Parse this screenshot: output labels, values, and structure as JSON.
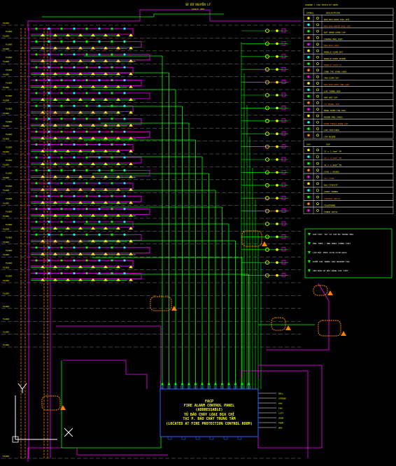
{
  "drawing": {
    "top_title": "SƠ ĐỒ NGUYÊN LÝ",
    "top_subtitle": "SCALE: NTS",
    "floor_label": "FLOOR",
    "colors": {
      "background": "#000000",
      "loop_green": "#00ff00",
      "loop_magenta": "#ff00ff",
      "riser_orange": "#ff8000",
      "device_yellow": "#ffff00",
      "cyan": "#00ffff",
      "blue": "#3060ff",
      "grey_dash": "#808080"
    }
  },
  "panel": {
    "lines": [
      "FACP",
      "FIRE ALARM CONTROL PANEL",
      "(ADDRESSABLE)",
      "TỦ BÁO CHÁY LOẠI ĐỊA CHỈ",
      "TẠI P. BÁO CHÁY TRUNG TÂM",
      "(LOCATED AT FIRE PROTECTION CONTROL ROOM)"
    ]
  },
  "legend_main": {
    "title": "LEGEND / CHÚ THÍCH KÝ HIỆU",
    "headers": [
      "SYMBOL",
      "DESCRIPTION"
    ],
    "rows": [
      "ĐẦU BÁO KHÓI ĐỊA CHỈ",
      "ĐẦU BÁO NHIỆT ĐỊA CHỈ",
      "NÚT NHẤN KHẨN CẤP",
      "CHUÔNG BÁO CHÁY",
      "ĐÈN BÁO CHÁY",
      "MODULE GIÁM SÁT",
      "MODULE ĐIỀU KHIỂN",
      "MODULE CÁCH LY",
      "CÔNG TẮC DÒNG CHẢY",
      "VAN GIÁM SÁT",
      "ĐẦU BÁO KHÓI ỐNG GIÓ",
      "LOA THÔNG BÁO",
      "HỘP NỐI DÂY",
      "TỦ TRUNG TÂM",
      "BẢNG HIỂN THỊ PHỤ",
      "NGUỒN PHỤ 24VDC",
      "ĐIỆN THOẠI KHẨN CẤP",
      "CÁP TÍN HIỆU",
      "CÁP NGUỒN"
    ]
  },
  "legend_wiring": {
    "headers": [
      "SYM",
      "CÁP"
    ],
    "rows": [
      "2C x 1.5mm² FR",
      "2C x 2.5mm² FR",
      "4C x 1.5mm² FR",
      "CAT6 / RS485",
      "SLC LOOP",
      "NAC CIRCUIT",
      "24VDC POWER",
      "CONTROL RELAY",
      "TELEPHONE",
      "FIBER OPTIC"
    ]
  },
  "legend_notes": {
    "rows": [
      "GHI CHÚ: TẤT CẢ CÁP ĐI TRONG ỐNG",
      "ỐNG THÉP / ỐNG NHỰA CHỐNG CHÁY",
      "LẮP ĐẶT THEO TCVN 5738:2021",
      "KIỂM TRA TRƯỚC KHI NGHIỆM THU",
      "XEM BẢN VẼ MẶT BẰNG CHI TIẾT"
    ]
  },
  "panel_outputs": [
    "BELL",
    "STROBE",
    "AHU",
    "FAN",
    "LIFT",
    "DOOR",
    "PUMP",
    "BMS"
  ],
  "ucs": {
    "x": "X",
    "y": "Y"
  }
}
